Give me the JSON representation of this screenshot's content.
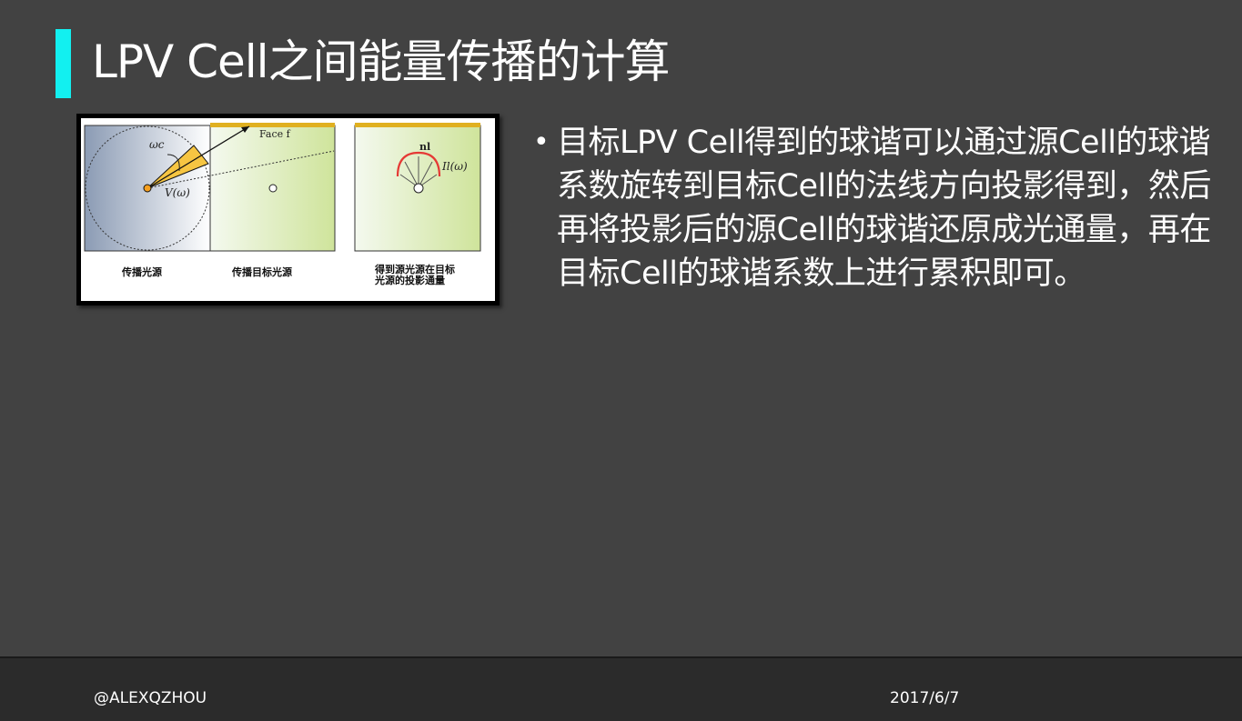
{
  "slide": {
    "title": "LPV Cell之间能量传播的计算",
    "bullet": "目标LPV Cell得到的球谐可以通过源Cell的球谐系数旋转到目标Cell的法线方向投影得到，然后再将投影后的源Cell的球谐还原成光通量，再在目标Cell的球谐系数上进行累积即可。",
    "bullet_marker": "•"
  },
  "figure": {
    "omega_c": "ωc",
    "face_label": "Face f",
    "v_omega": "V(ω)",
    "n_label": "nl",
    "i_omega": "Il(ω)",
    "caption_1": "传播光源",
    "caption_2": "传播目标光源",
    "caption_3_line1": "得到源光源在目标",
    "caption_3_line2": "光源的投影通量",
    "colors": {
      "wedge": "#f6c542",
      "face_bar": "#e0b020",
      "target_red": "#e53935"
    }
  },
  "footer": {
    "author": "@ALEXQZHOU",
    "date": "2017/6/7"
  },
  "theme": {
    "accent": "#12f0f0",
    "background": "#424242",
    "footer_bg": "#2b2b2b"
  }
}
